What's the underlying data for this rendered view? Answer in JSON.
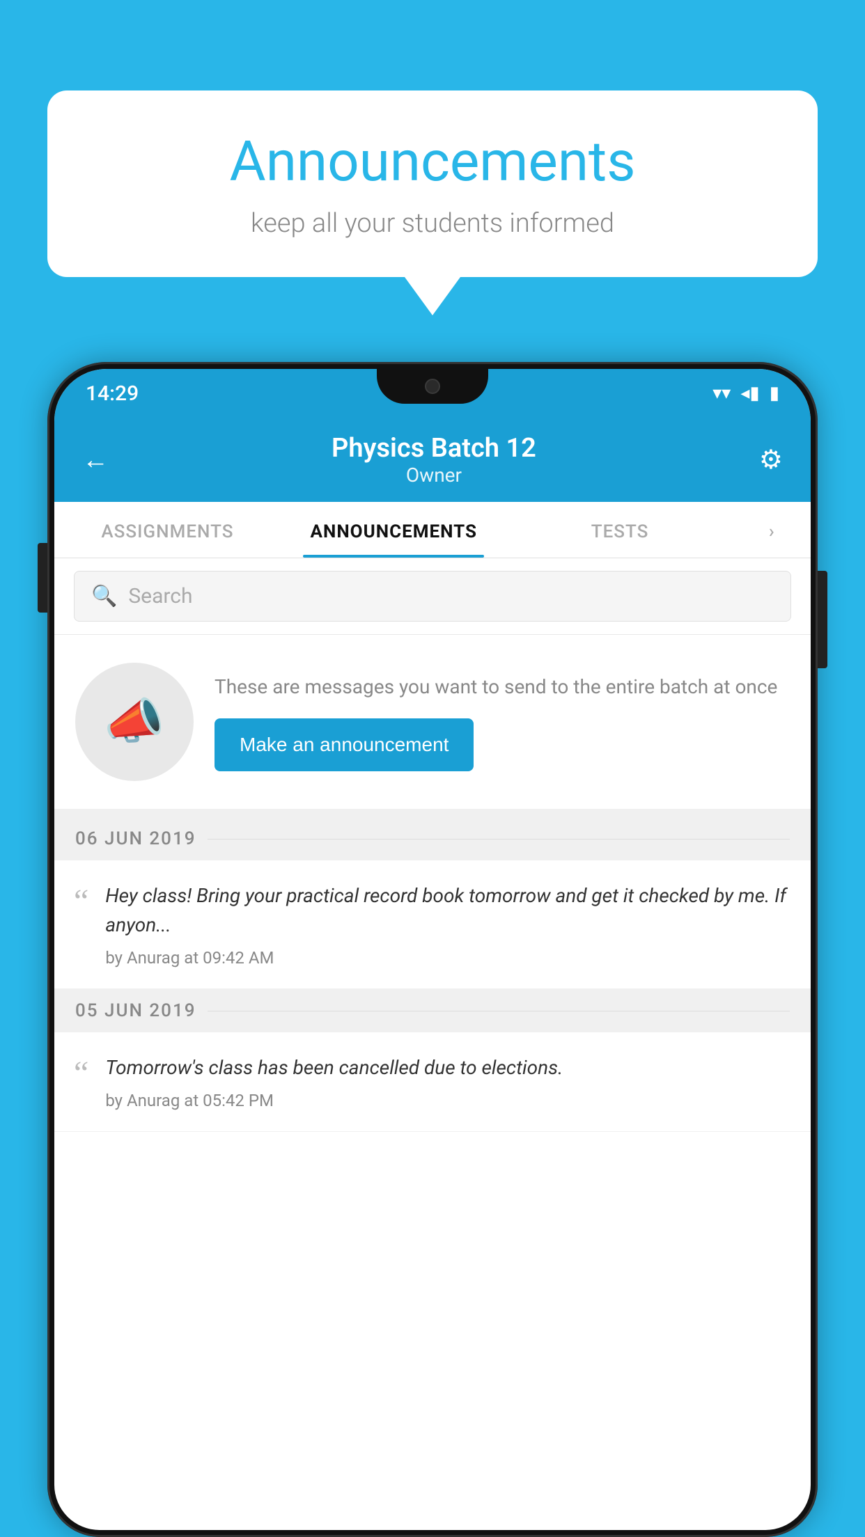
{
  "page": {
    "background_color": "#29b6e8"
  },
  "speech_bubble": {
    "title": "Announcements",
    "subtitle": "keep all your students informed"
  },
  "status_bar": {
    "time": "14:29",
    "wifi": "▼",
    "signal": "◂",
    "battery": "▮"
  },
  "app_header": {
    "back_label": "←",
    "title": "Physics Batch 12",
    "subtitle": "Owner",
    "gear_label": "⚙"
  },
  "tabs": {
    "items": [
      {
        "label": "ASSIGNMENTS",
        "active": false
      },
      {
        "label": "ANNOUNCEMENTS",
        "active": true
      },
      {
        "label": "TESTS",
        "active": false
      },
      {
        "label": "...",
        "active": false
      }
    ]
  },
  "search": {
    "placeholder": "Search"
  },
  "promo": {
    "description": "These are messages you want to send to the entire batch at once",
    "button_label": "Make an announcement"
  },
  "announcements": [
    {
      "date": "06  JUN  2019",
      "message": "Hey class! Bring your practical record book tomorrow and get it checked by me. If anyon...",
      "meta": "by Anurag at 09:42 AM"
    },
    {
      "date": "05  JUN  2019",
      "message": "Tomorrow's class has been cancelled due to elections.",
      "meta": "by Anurag at 05:42 PM"
    }
  ]
}
